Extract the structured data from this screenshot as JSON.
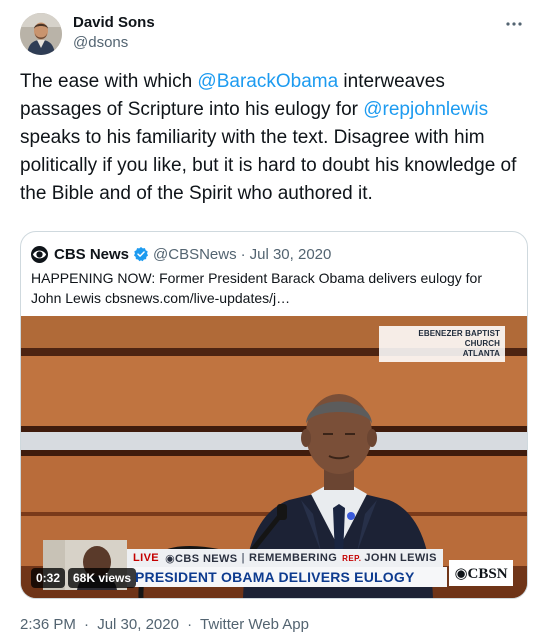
{
  "author": {
    "name": "David Sons",
    "handle": "@dsons",
    "avatar_icon": "profile-photo"
  },
  "tweet": {
    "text_1": "The ease with which ",
    "mention_1": "@BarackObama",
    "text_2": " interweaves passages of Scripture into his eulogy for ",
    "mention_2": "@repjohnlewis",
    "text_3": " speaks to his familiarity with the text. Disagree with him politically if you like, but it is hard to doubt his knowledge of the Bible and of the Spirit who authored it."
  },
  "quote": {
    "name": "CBS News",
    "handle": "@CBSNews",
    "dot": "·",
    "date": "Jul 30, 2020",
    "text": "HAPPENING NOW: Former President Barack Obama delivers eulogy for John Lewis ",
    "link": "cbsnews.com/live-updates/j…",
    "logo_icon": "cbs-eye-icon",
    "verified_icon": "verified-badge-icon"
  },
  "video": {
    "church_tag_line1": "EBENEZER BAPTIST CHURCH",
    "church_tag_line2": "ATLANTA",
    "live_label": "LIVE",
    "network_label": "◉CBS NEWS",
    "separator": "|",
    "remembering_label": "REMEMBERING",
    "rep_label": "REP.",
    "name_label": "JOHN LEWIS",
    "headline": "PRESIDENT OBAMA DELIVERS EULOGY",
    "brand": "◉CBSN",
    "duration": "0:32",
    "views": "68K views"
  },
  "meta": {
    "time": "2:36 PM",
    "dot1": "·",
    "date": "Jul 30, 2020",
    "dot2": "·",
    "source": "Twitter Web App"
  },
  "colors": {
    "link": "#1d9bf0",
    "secondary_text": "#536471",
    "border": "#cfd9de",
    "verified": "#1d9bf0"
  }
}
